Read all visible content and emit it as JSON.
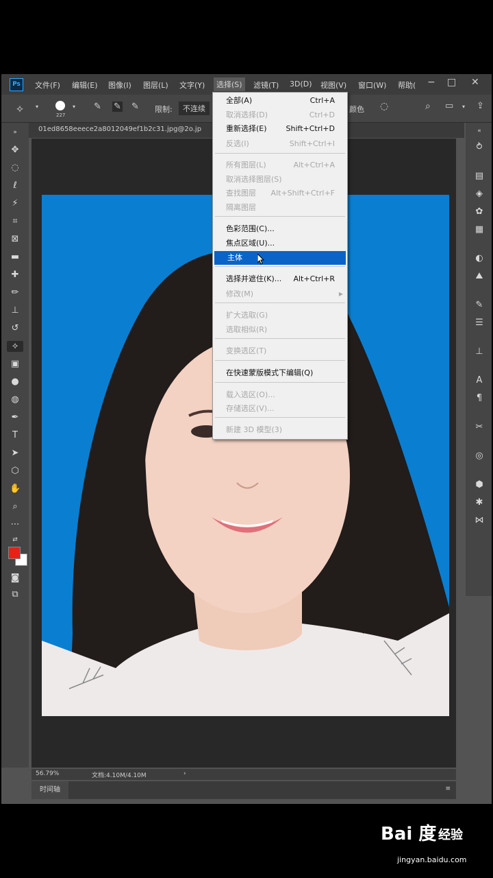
{
  "menubar": {
    "logo": "Ps",
    "items": [
      "文件(F)",
      "编辑(E)",
      "图像(I)",
      "图层(L)",
      "文字(Y)",
      "选择(S)",
      "滤镜(T)",
      "3D(D)",
      "视图(V)",
      "窗口(W)",
      "帮助("
    ],
    "active_index": 5
  },
  "options": {
    "brush_size": "227",
    "limit_label": "限制:",
    "limit_value": "不连续",
    "color_label": "颜色"
  },
  "document": {
    "tab_title": "01ed8658eeece2a8012049ef1b2c31.jpg@2o.jp"
  },
  "dropdown": {
    "items": [
      {
        "label": "全部(A)",
        "shortcut": "Ctrl+A",
        "enabled": true
      },
      {
        "label": "取消选择(D)",
        "shortcut": "Ctrl+D",
        "enabled": false
      },
      {
        "label": "重新选择(E)",
        "shortcut": "Shift+Ctrl+D",
        "enabled": true
      },
      {
        "label": "反选(I)",
        "shortcut": "Shift+Ctrl+I",
        "enabled": false
      },
      {
        "label": "所有图层(L)",
        "shortcut": "Alt+Ctrl+A",
        "enabled": false
      },
      {
        "label": "取消选择图层(S)",
        "shortcut": "",
        "enabled": false
      },
      {
        "label": "查找图层",
        "shortcut": "Alt+Shift+Ctrl+F",
        "enabled": false
      },
      {
        "label": "隔离图层",
        "shortcut": "",
        "enabled": false
      },
      {
        "label": "色彩范围(C)...",
        "shortcut": "",
        "enabled": true
      },
      {
        "label": "焦点区域(U)...",
        "shortcut": "",
        "enabled": true
      },
      {
        "label": "主体",
        "shortcut": "",
        "enabled": true,
        "highlighted": true
      },
      {
        "label": "选择并遮住(K)...",
        "shortcut": "Alt+Ctrl+R",
        "enabled": true
      },
      {
        "label": "修改(M)",
        "shortcut": "",
        "enabled": false,
        "submenu": true
      },
      {
        "label": "扩大选取(G)",
        "shortcut": "",
        "enabled": false
      },
      {
        "label": "选取相似(R)",
        "shortcut": "",
        "enabled": false
      },
      {
        "label": "变换选区(T)",
        "shortcut": "",
        "enabled": false
      },
      {
        "label": "在快速蒙版模式下编辑(Q)",
        "shortcut": "",
        "enabled": true
      },
      {
        "label": "载入选区(O)...",
        "shortcut": "",
        "enabled": false
      },
      {
        "label": "存储选区(V)...",
        "shortcut": "",
        "enabled": false
      },
      {
        "label": "新建 3D 模型(3)",
        "shortcut": "",
        "enabled": false
      }
    ]
  },
  "status": {
    "zoom": "56.79%",
    "doc_info": "文档:4.10M/4.10M"
  },
  "timeline": {
    "tab": "时间轴"
  },
  "watermark": {
    "logo": "Bai 度",
    "text": "经验",
    "url": "jingyan.baidu.com"
  },
  "colors": {
    "photo_background": "#0a7fd1",
    "foreground_swatch": "#e8201a",
    "highlight": "#0a64c8"
  }
}
